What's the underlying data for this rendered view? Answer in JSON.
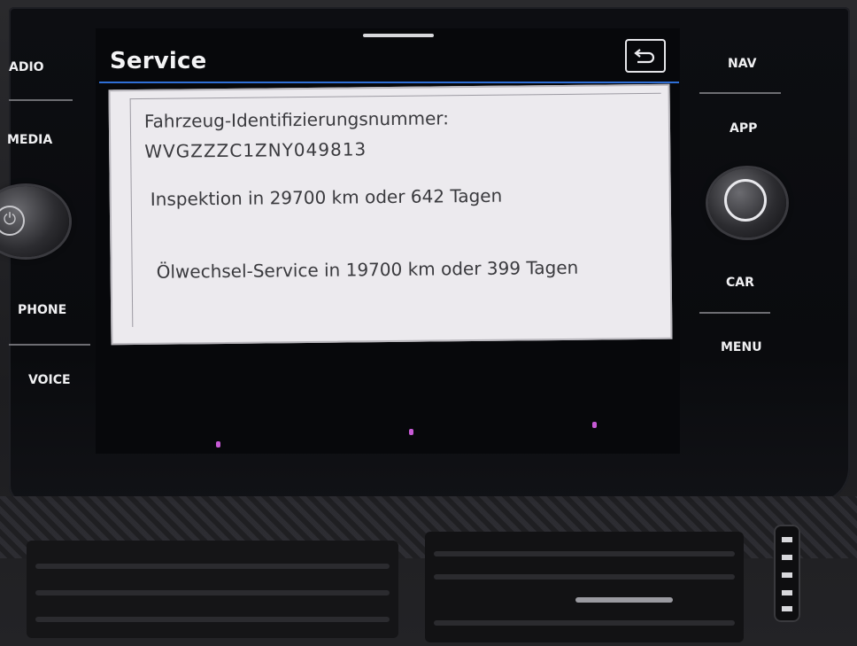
{
  "header": {
    "title": "Service"
  },
  "service": {
    "vin_label": "Fahrzeug-Identifizierungsnummer:",
    "vin_value": "WVGZZZC1ZNY049813",
    "inspection": "Inspektion in 29700 km oder 642 Tagen",
    "oil_service": "Ölwechsel-Service in 19700 km oder 399 Tagen"
  },
  "left_buttons": {
    "radio": "ADIO",
    "media": "MEDIA",
    "phone": "PHONE",
    "voice": "VOICE"
  },
  "right_buttons": {
    "nav": "NAV",
    "app": "APP",
    "car": "CAR",
    "menu": "MENU"
  },
  "icons": {
    "back": "back-arrow-icon",
    "power": "power-icon"
  },
  "colors": {
    "accent": "#2f6fd6",
    "panel_bg": "#eceaee",
    "text": "#3a3a3e",
    "ambient_dot": "#c75ad6"
  }
}
